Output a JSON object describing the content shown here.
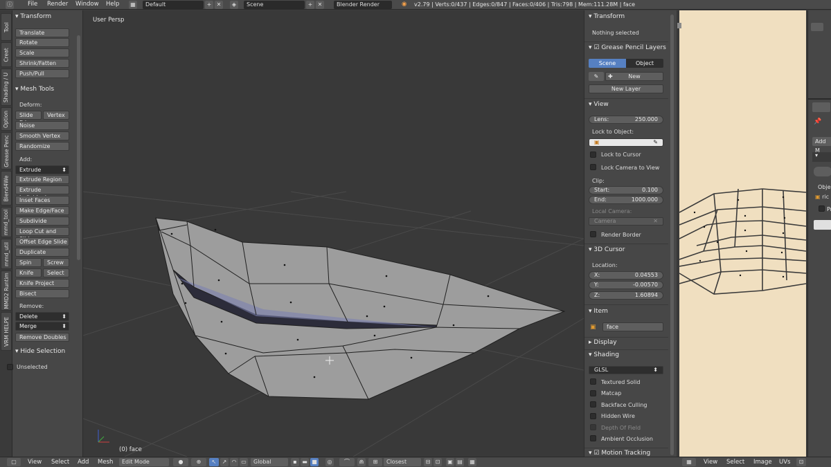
{
  "topbar": {
    "menus": [
      "File",
      "Render",
      "Window",
      "Help"
    ],
    "screen_layout": "Default",
    "scene": "Scene",
    "engine": "Blender Render",
    "stats": "v2.79 | Verts:0/437 | Edges:0/847 | Faces:0/406 | Tris:798 | Mem:111.28M | face"
  },
  "tabs": [
    "Tool",
    "Creat",
    "Shading / U",
    "Option",
    "Grease Penc",
    "Blend4We",
    "mmd_tool",
    "mmd_util",
    "MMD2 Runtim",
    "VRM HELPE"
  ],
  "toolshelf": {
    "transform_header": "Transform",
    "transform_buttons": [
      "Translate",
      "Rotate",
      "Scale",
      "Shrink/Fatten",
      "Push/Pull"
    ],
    "mesh_tools_header": "Mesh Tools",
    "deform_label": "Deform:",
    "slide_edge": "Slide Ed",
    "vertex": "Vertex",
    "noise": "Noise",
    "smooth_vertex": "Smooth Vertex",
    "randomize": "Randomize",
    "add_label": "Add:",
    "extrude": "Extrude",
    "add_buttons": [
      "Extrude Region",
      "Extrude Individual",
      "Inset Faces",
      "Make Edge/Face",
      "Subdivide",
      "Loop Cut and Slide",
      "Offset Edge Slide",
      "Duplicate"
    ],
    "spin": "Spin",
    "screw": "Screw",
    "knife": "Knife",
    "select": "Select",
    "knife_project": "Knife Project",
    "bisect": "Bisect",
    "remove_label": "Remove:",
    "delete": "Delete",
    "merge": "Merge",
    "remove_doubles": "Remove Doubles",
    "hide_selection_header": "Hide Selection",
    "unselected": "Unselected"
  },
  "viewport": {
    "view_label": "User Persp",
    "object_label": "(0) face"
  },
  "properties": {
    "transform_header": "Transform",
    "nothing_selected": "Nothing selected",
    "grease_pencil_header": "Grease Pencil Layers",
    "scene_btn": "Scene",
    "object_btn": "Object",
    "new_btn": "New",
    "new_layer_btn": "New Layer",
    "view_header": "View",
    "lens_label": "Lens:",
    "lens_value": "250.000",
    "lock_to_object": "Lock to Object:",
    "lock_to_cursor": "Lock to Cursor",
    "lock_camera": "Lock Camera to View",
    "clip_label": "Clip:",
    "start_label": "Start:",
    "start_value": "0.100",
    "end_label": "End:",
    "end_value": "1000.000",
    "local_camera": "Local Camera:",
    "camera_field": "Camera",
    "render_border": "Render Border",
    "cursor_header": "3D Cursor",
    "location_label": "Location:",
    "x_label": "X:",
    "x_value": "0.04553",
    "y_label": "Y:",
    "y_value": "-0.00570",
    "z_label": "Z:",
    "z_value": "1.60894",
    "item_header": "Item",
    "item_name": "face",
    "display_header": "Display",
    "shading_header": "Shading",
    "shading_mode": "GLSL",
    "textured_solid": "Textured Solid",
    "matcap": "Matcap",
    "backface_culling": "Backface Culling",
    "hidden_wire": "Hidden Wire",
    "depth_of_field": "Depth Of Field",
    "ambient_occlusion": "Ambient Occlusion",
    "motion_tracking": "Motion Tracking"
  },
  "farright": {
    "add_label": "Add M",
    "obj_label": "Objec",
    "item_r1": "ric",
    "item_r2": "Pr"
  },
  "bottombar": {
    "view": "View",
    "select": "Select",
    "add": "Add",
    "mesh": "Mesh",
    "mode": "Edit Mode",
    "orientation": "Global",
    "snap": "Closest",
    "uv_view": "View",
    "uv_select": "Select",
    "uv_image": "Image",
    "uv_uvs": "UVs"
  }
}
